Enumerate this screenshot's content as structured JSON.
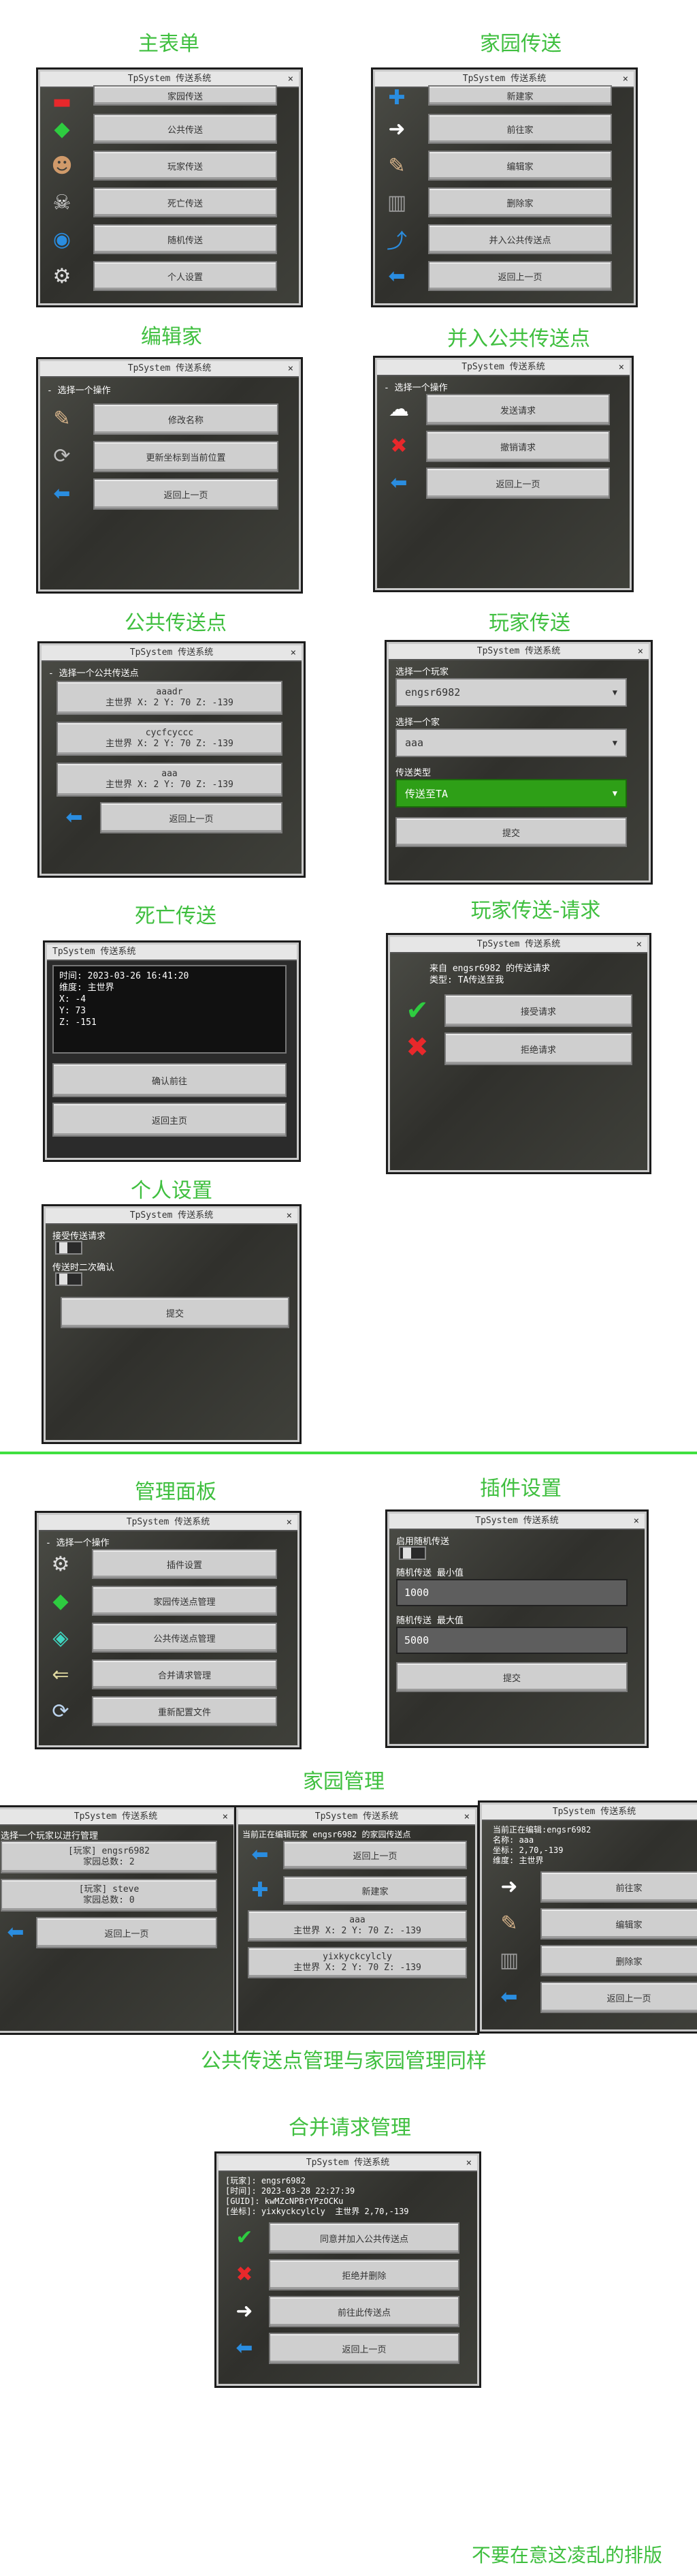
{
  "titles": {
    "main_menu": "主表单",
    "home_tp": "家园传送",
    "edit_home": "编辑家",
    "merge_public": "并入公共传送点",
    "public_tp": "公共传送点",
    "player_tp": "玩家传送",
    "death_tp": "死亡传送",
    "player_req": "玩家传送-请求",
    "personal": "个人设置",
    "admin": "管理面板",
    "plugin": "插件设置",
    "home_mgmt": "家园管理",
    "public_same": "公共传送点管理与家园管理同样",
    "merge_mgmt": "合并请求管理",
    "footer": "不要在意这凌乱的排版"
  },
  "window_title": "TpSystem 传送系统",
  "close_glyph": "×",
  "choose_op": "- 选择一个操作",
  "main_menu": [
    "家园传送",
    "公共传送",
    "玩家传送",
    "死亡传送",
    "随机传送",
    "个人设置"
  ],
  "home_tp": [
    "新建家",
    "前往家",
    "编辑家",
    "删除家",
    "并入公共传送点",
    "返回上一页"
  ],
  "edit_home": [
    "修改名称",
    "更新坐标到当前位置",
    "返回上一页"
  ],
  "merge_public": [
    "发送请求",
    "撤销请求",
    "返回上一页"
  ],
  "public_tp": {
    "op": "- 选择一个公共传送点",
    "items": [
      {
        "name": "aaadr",
        "info": "主世界 X: 2 Y: 70 Z: -139"
      },
      {
        "name": "cycfcyccc",
        "info": "主世界 X: 2 Y: 70 Z: -139"
      },
      {
        "name": "aaa",
        "info": "主世界 X: 2 Y: 70 Z: -139"
      }
    ],
    "back": "返回上一页"
  },
  "player_tp": {
    "player_label": "选择一个玩家",
    "player_value": "engsr6982",
    "home_label": "选择一个家",
    "home_value": "aaa",
    "type_label": "传送类型",
    "type_value": "传送至TA",
    "submit": "提交",
    "arrow": "▼"
  },
  "death_tp": {
    "info": "时间: 2023-03-26 16:41:20\n维度: 主世界\nX: -4\nY: 73\nZ: -151",
    "confirm": "确认前往",
    "back": "返回主页"
  },
  "player_req": {
    "info": "来自 engsr6982 的传送请求\n类型: TA传送至我",
    "accept": "接受请求",
    "deny": "拒绝请求"
  },
  "personal": {
    "opt1": "接受传送请求",
    "opt2": "传送时二次确认",
    "submit": "提交"
  },
  "admin": [
    "插件设置",
    "家园传送点管理",
    "公共传送点管理",
    "合并请求管理",
    "重新配置文件"
  ],
  "plugin": {
    "enable": "启用随机传送",
    "min_label": "随机传送 最小值",
    "min_value": "1000",
    "max_label": "随机传送 最大值",
    "max_value": "5000",
    "submit": "提交"
  },
  "home_mgmt": {
    "win1": {
      "op": "选择一个玩家以进行管理",
      "items": [
        {
          "name": "[玩家] engsr6982",
          "info": "家园总数: 2"
        },
        {
          "name": "[玩家] steve",
          "info": "家园总数: 0"
        }
      ],
      "back": "返回上一页"
    },
    "win2": {
      "op": "当前正在编辑玩家 engsr6982 的家园传送点",
      "back": "返回上一页",
      "new": "新建家",
      "items": [
        {
          "name": "aaa",
          "info": "主世界 X: 2 Y: 70 Z: -139"
        },
        {
          "name": "yixkyckcylcly",
          "info": "主世界 X: 2 Y: 70 Z: -139"
        }
      ]
    },
    "win3": {
      "info": "当前正在编辑:engsr6982\n名称: aaa\n坐标: 2,70,-139\n维度: 主世界",
      "items": [
        "前往家",
        "编辑家",
        "删除家",
        "返回上一页"
      ]
    }
  },
  "merge_mgmt": {
    "info": "[玩家]: engsr6982\n[时间]: 2023-03-28 22:27:39\n[GUID]: kwMZcNPBrYPzOCKu\n[坐标]: yixkyckcylcly  主世界 2,70,-139",
    "items": [
      "同意并加入公共传送点",
      "拒绝并删除",
      "前往此传送点",
      "返回上一页"
    ]
  },
  "icon_colors": {
    "green": "#2ecc40",
    "red": "#e8282b",
    "blue": "#2a8de0",
    "white": "#ffffff",
    "gray": "#9a9a9a"
  }
}
